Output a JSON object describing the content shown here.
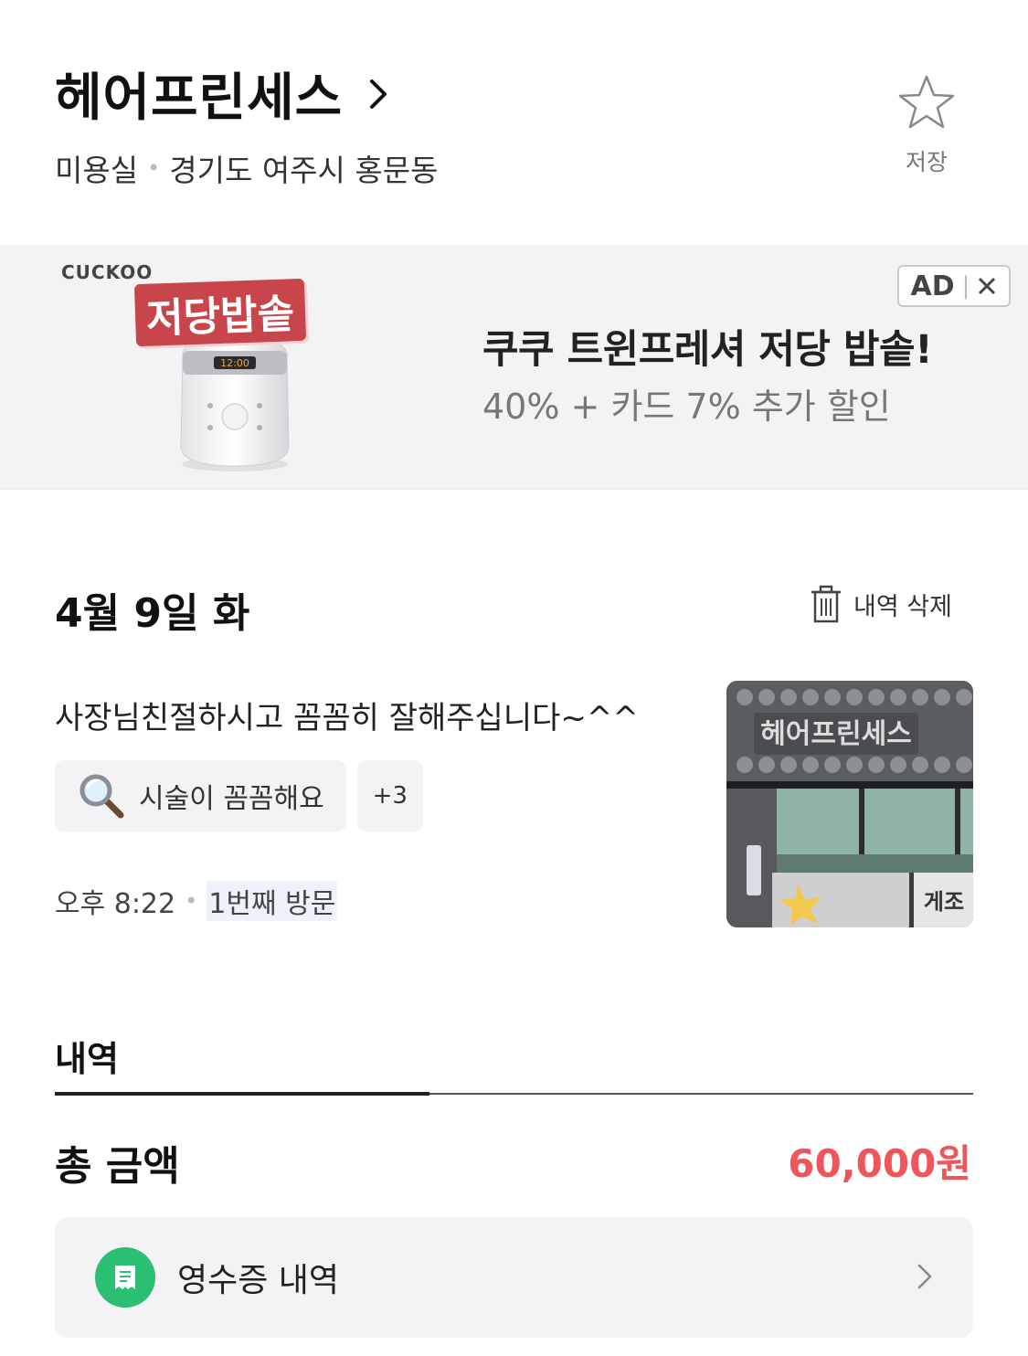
{
  "header": {
    "store_name": "헤어프린세스",
    "category": "미용실",
    "location": "경기도 여주시 홍문동",
    "save_label": "저장"
  },
  "ad": {
    "brand": "CUCKOO",
    "badge_text": "저당밥솥",
    "ad_label": "AD",
    "headline": "쿠쿠 트윈프레셔 저당 밥솥!",
    "subline": "40% + 카드 7% 추가 할인"
  },
  "review": {
    "date": "4월 9일 화",
    "delete_label": "내역 삭제",
    "text": "사장님친절하시고 꼼꼼히 잘해주십니다~^^",
    "tag_label": "시술이 꼼꼼해요",
    "tag_more": "+3",
    "time": "오후 8:22",
    "visit_count": "1번째 방문",
    "photo_sign": "헤어프린세스"
  },
  "history": {
    "tab_label": "내역",
    "total_label": "총 금액",
    "total_amount": "60,000원",
    "receipt_label": "영수증 내역"
  },
  "colors": {
    "accent_red": "#f0555b",
    "receipt_green": "#2bbf73",
    "ad_badge": "#c9454c"
  },
  "icons": [
    "chevron-right-icon",
    "star-icon",
    "close-icon",
    "trash-icon",
    "magnifier-icon",
    "receipt-icon"
  ]
}
